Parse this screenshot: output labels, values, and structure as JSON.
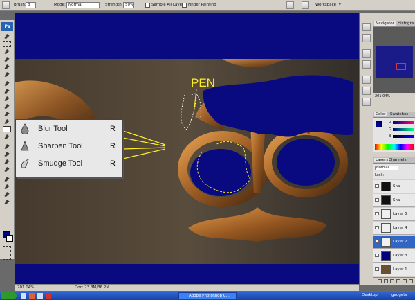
{
  "options_bar": {
    "brush_label": "Brush:",
    "brush_size": "8",
    "mode_label": "Mode:",
    "mode_value": "Normal",
    "strength_label": "Strength:",
    "strength_value": "50%",
    "sample_all_layers_label": "Sample All Layers",
    "finger_painting_label": "Finger Painting",
    "workspace_label": "Workspace"
  },
  "toolbox": {
    "logo": "Ps",
    "foreground_color": "#000080",
    "background_color": "#ffffff"
  },
  "canvas": {
    "annotation_text": "PEN",
    "annotation_color": "#ffee22",
    "fill_color": "#0a0a80"
  },
  "tool_flyout": {
    "items": [
      {
        "label": "Blur Tool",
        "key": "R",
        "icon": "blur-drop-icon"
      },
      {
        "label": "Sharpen Tool",
        "key": "R",
        "icon": "sharpen-cone-icon"
      },
      {
        "label": "Smudge Tool",
        "key": "R",
        "icon": "smudge-finger-icon"
      }
    ]
  },
  "status_bar": {
    "zoom": "201.04%",
    "doc": "Doc: 23.3M/36.2M"
  },
  "navigator": {
    "tabs": [
      "Navigator",
      "Histogra"
    ],
    "zoom": "201.04%"
  },
  "color_panel": {
    "tabs": [
      "Color",
      "Swatches"
    ],
    "sliders": [
      "R",
      "G",
      "B"
    ]
  },
  "layers_panel": {
    "tabs": [
      "Layers",
      "Channels"
    ],
    "blend_mode": "Normal",
    "lock_label": "Lock:",
    "layers": [
      {
        "name": "Sha",
        "active": false,
        "thumb": "#111111"
      },
      {
        "name": "Sha",
        "active": false,
        "thumb": "#111111"
      },
      {
        "name": "Layer 5",
        "active": false,
        "thumb": "#f0f0f0"
      },
      {
        "name": "Layer 4",
        "active": false,
        "thumb": "#f0f0f0"
      },
      {
        "name": "Layer 2",
        "active": true,
        "thumb": "#f0f0f0"
      },
      {
        "name": "Layer 3",
        "active": false,
        "thumb": "#000080"
      },
      {
        "name": "Layer 1",
        "active": false,
        "thumb": "#6b5030"
      }
    ]
  },
  "taskbar": {
    "start_app": "Adobe Photoshop C...",
    "desktop_label": "Desktop",
    "gadgets_label": "gadgets"
  }
}
